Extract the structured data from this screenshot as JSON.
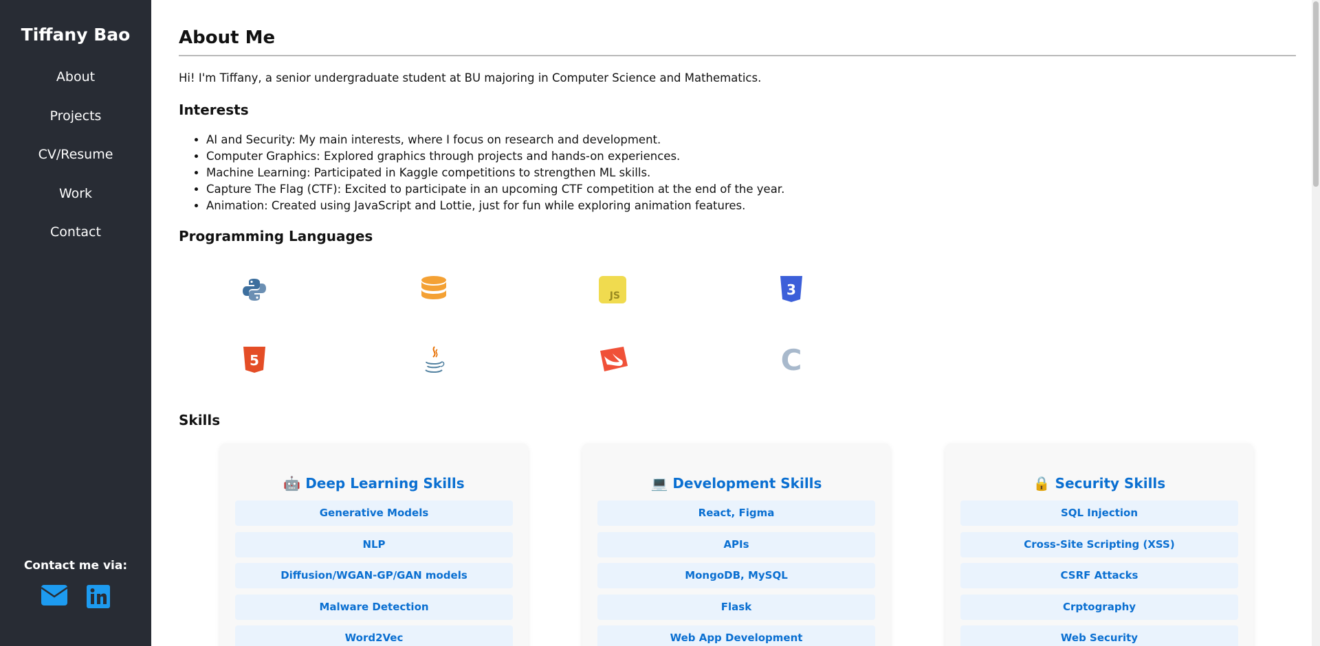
{
  "sidebar": {
    "name": "Tiffany Bao",
    "nav": [
      "About",
      "Projects",
      "CV/Resume",
      "Work",
      "Contact"
    ],
    "contact_label": "Contact me via:",
    "contact_icons": [
      "email-icon",
      "linkedin-icon"
    ],
    "icon_color": "#1d9bf0"
  },
  "main": {
    "title": "About Me",
    "intro": "Hi! I'm Tiffany, a senior undergraduate student at BU majoring in Computer Science and Mathematics.",
    "interests_heading": "Interests",
    "interests": [
      "AI and Security: My main interests, where I focus on research and development.",
      "Computer Graphics: Explored graphics through projects and hands-on experiences.",
      "Machine Learning: Participated in Kaggle competitions to strengthen ML skills.",
      "Capture The Flag (CTF): Excited to participate in an upcoming CTF competition at the end of the year.",
      "Animation: Created using JavaScript and Lottie, just for fun while exploring animation features."
    ],
    "languages_heading": "Programming Languages",
    "languages": [
      {
        "icon": "python-icon"
      },
      {
        "icon": "database-icon"
      },
      {
        "icon": "javascript-icon",
        "text": "JS"
      },
      {
        "icon": "css3-icon",
        "text": "3"
      },
      {
        "icon": "html5-icon",
        "text": "5"
      },
      {
        "icon": "java-icon"
      },
      {
        "icon": "swift-icon"
      },
      {
        "icon": "c-language-icon",
        "text": "C"
      }
    ],
    "skills_heading": "Skills",
    "skills": [
      {
        "emoji": "🤖",
        "title": "Deep Learning Skills",
        "items": [
          "Generative Models",
          "NLP",
          "Diffusion/WGAN-GP/GAN models",
          "Malware Detection",
          "Word2Vec"
        ]
      },
      {
        "emoji": "💻",
        "title": "Development Skills",
        "items": [
          "React, Figma",
          "APIs",
          "MongoDB, MySQL",
          "Flask",
          "Web App Development"
        ]
      },
      {
        "emoji": "🔒",
        "title": "Security Skills",
        "items": [
          "SQL Injection",
          "Cross-Site Scripting (XSS)",
          "CSRF Attacks",
          "Crptography",
          "Web Security"
        ]
      }
    ],
    "accent_color": "#0a6fd1"
  }
}
